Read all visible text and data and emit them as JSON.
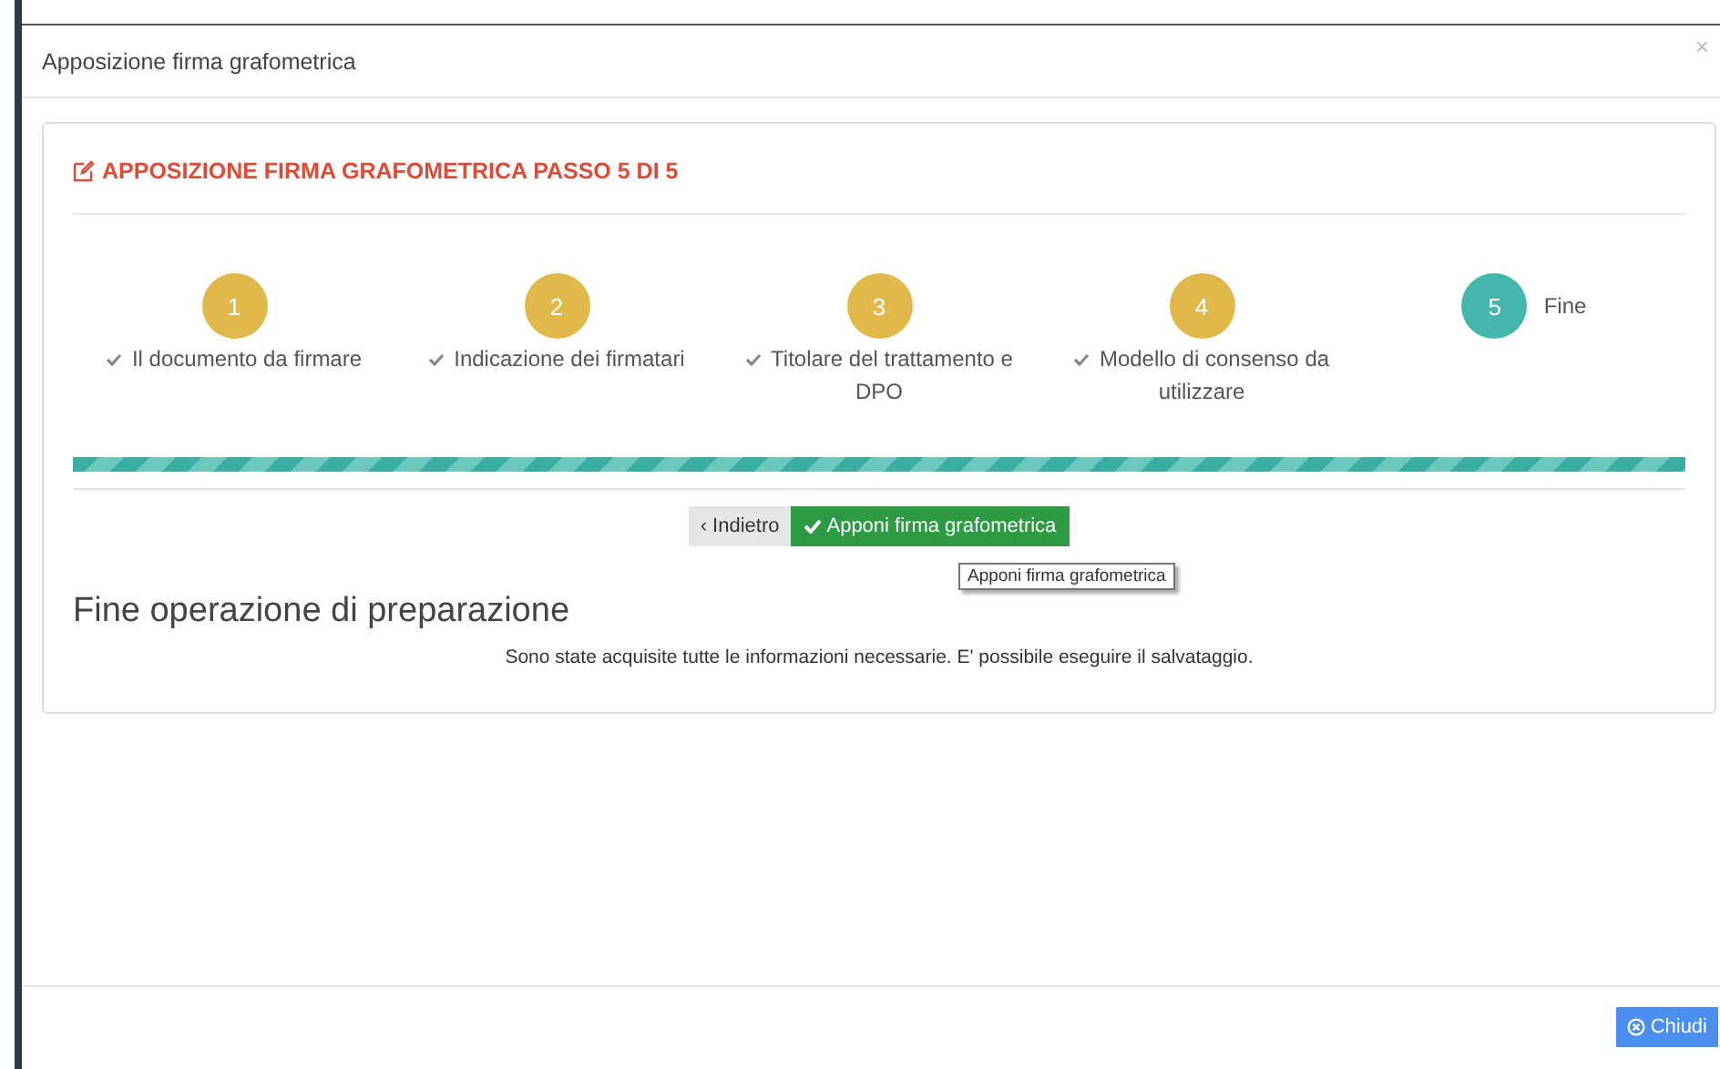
{
  "window": {
    "title": "Apposizione firma grafometrica",
    "close": "×"
  },
  "panel": {
    "heading": "APPOSIZIONE FIRMA GRAFOMETRICA PASSO 5 DI 5",
    "steps": [
      {
        "number": "1",
        "label": "Il documento da firmare",
        "completed": true,
        "selected": false
      },
      {
        "number": "2",
        "label": "Indicazione dei firmatari",
        "completed": true,
        "selected": false
      },
      {
        "number": "3",
        "label": "Titolare del trattamento e DPO",
        "completed": true,
        "selected": false
      },
      {
        "number": "4",
        "label": "Modello di consenso da utilizzare",
        "completed": true,
        "selected": false
      },
      {
        "number": "5",
        "label": "Fine",
        "selected": true
      }
    ],
    "progress": {
      "level": 1
    },
    "back_button": "‹ Indietro",
    "confirm_button": "Apponi firma grafometrica",
    "tooltip": "Apponi firma grafometrica",
    "section_title": "Fine operazione di preparazione",
    "message": "Sono state acquisite tutte le informazioni necessarie. E' possibile eseguire il salvataggio."
  },
  "footer": {
    "close_button": "Chiudi"
  }
}
